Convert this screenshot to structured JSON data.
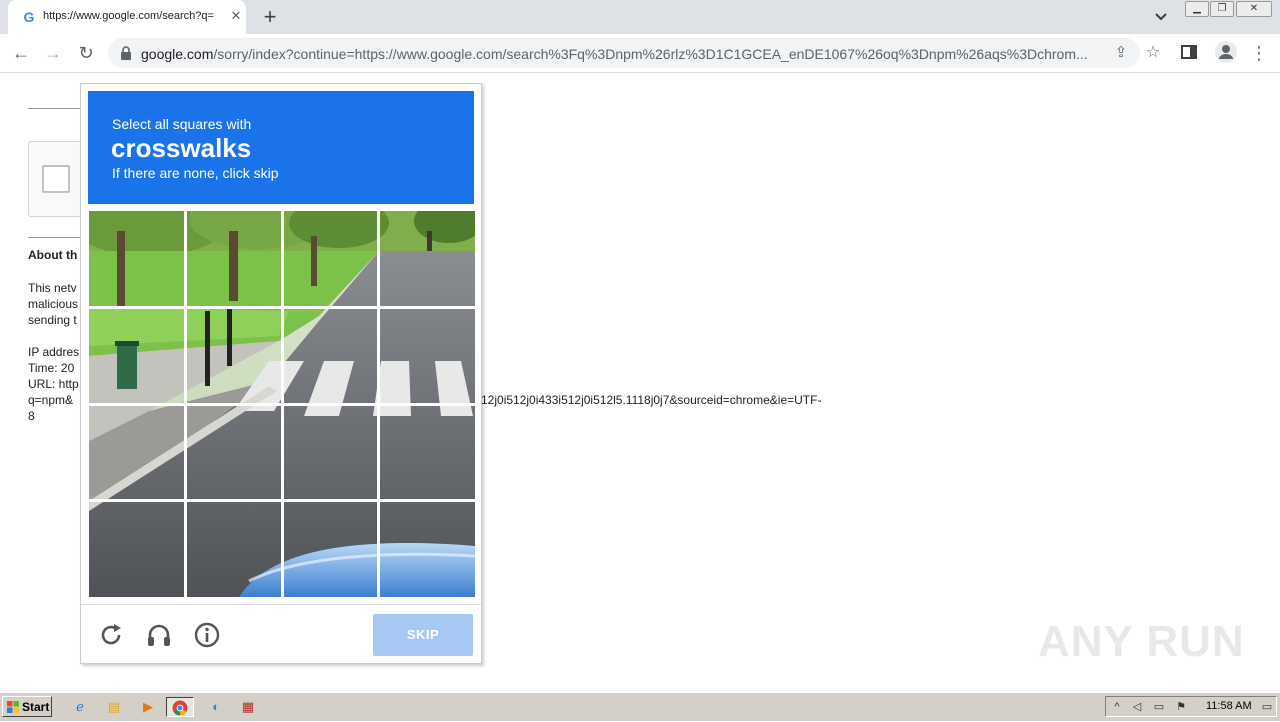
{
  "browser": {
    "tab_title": "https://www.google.com/search?q=",
    "tab_favicon": "G",
    "url_host": "google.com",
    "url_rest": "/sorry/index?continue=https://www.google.com/search%3Fq%3Dnpm%26rlz%3D1C1GCEA_enDE1067%26oq%3Dnpm%26aqs%3Dchrom..."
  },
  "page": {
    "about_heading": "About th",
    "body_line1": "This netv",
    "body_line2": "malicious",
    "body_line3": "sending t",
    "ip_line": "IP addres",
    "time_line": "Time: 20",
    "url_line": "URL: http",
    "query_line": "q=npm&",
    "url_tail": "12j0i512j0i433i512j0i512l5.1118j0j7&sourceid=chrome&ie=UTF-",
    "url_tail2": "8"
  },
  "challenge": {
    "instruction": "Select all squares with",
    "keyword": "crosswalks",
    "hint": "If there are none, click skip",
    "skip_label": "SKIP",
    "accent_color": "#1a73e8",
    "skip_color": "#a7c8f2"
  },
  "watermark": "ANY RUN",
  "taskbar": {
    "start_label": "Start",
    "clock": "11:58 AM"
  }
}
